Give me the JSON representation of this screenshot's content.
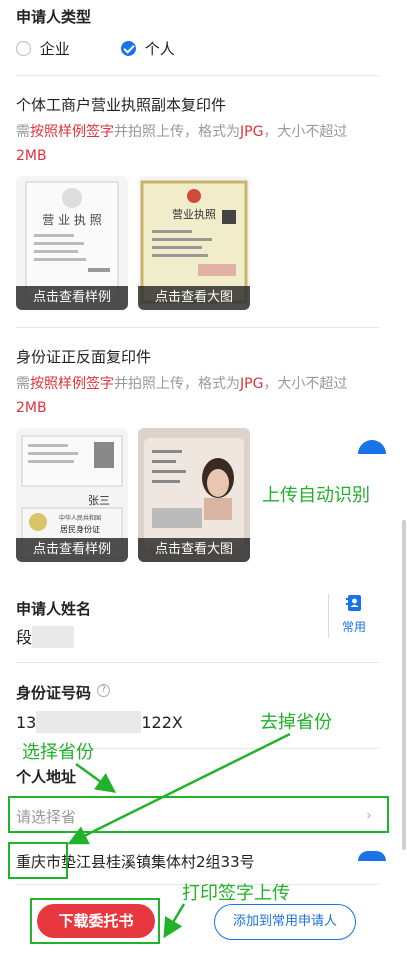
{
  "applicant_type": {
    "label": "申请人类型",
    "options": [
      {
        "label": "企业",
        "selected": false
      },
      {
        "label": "个人",
        "selected": true
      }
    ]
  },
  "license_section": {
    "title": "个体工商户营业执照副本复印件",
    "hint_prefix": "需",
    "hint_red1": "按照样例签字",
    "hint_mid": "并拍照上传，格式为",
    "hint_red2": "JPG",
    "hint_suffix": "，大小不超过",
    "hint_red3": "2MB",
    "sample_caption": "点击查看样例",
    "large_caption": "点击查看大图",
    "sample_title": "营 业 执 照",
    "large_title": "营业执照"
  },
  "id_section": {
    "title": "身份证正反面复印件",
    "hint_prefix": "需",
    "hint_red1": "按照样例签字",
    "hint_mid": "并拍照上传，格式为",
    "hint_red2": "JPG",
    "hint_suffix": "，大小不超过",
    "hint_red3": "2MB",
    "sample_caption": "点击查看样例",
    "large_caption": "点击查看大图",
    "signature": "张三",
    "card_line1": "中华人民共和国",
    "card_line2": "居民身份证"
  },
  "applicant_name": {
    "label": "申请人姓名",
    "value": "段",
    "common_label": "常用"
  },
  "id_number": {
    "label": "身份证号码",
    "value_start": "13",
    "value_end": "122X"
  },
  "address": {
    "label": "个人地址",
    "province_placeholder": "请选择省",
    "detail_city": "重庆市",
    "detail_rest": "垫江县桂溪镇集体村2组33号"
  },
  "footer": {
    "download_label": "下载委托书",
    "add_common_label": "添加到常用申请人"
  },
  "annotations": {
    "upload_auto": "上传自动识别",
    "remove_province": "去掉省份",
    "select_province": "选择省份",
    "print_sign_upload": "打印签字上传"
  },
  "colors": {
    "accent": "#1a73e8",
    "red": "#e0333b",
    "annotation": "#22b22a"
  }
}
